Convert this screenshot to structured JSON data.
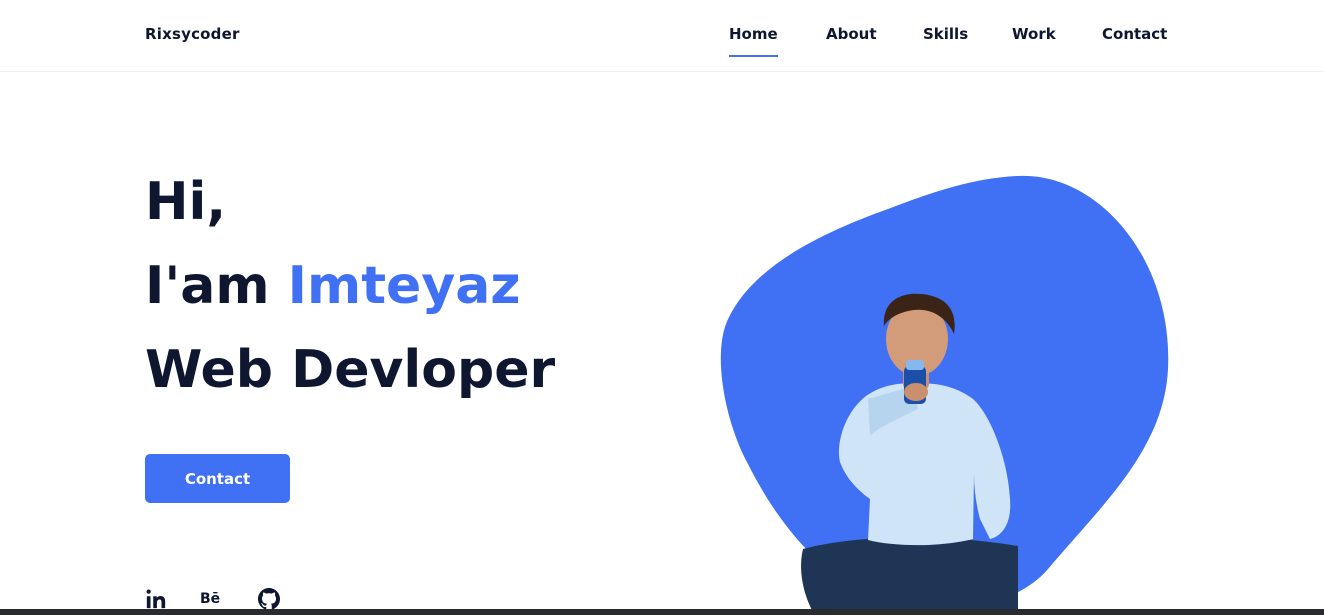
{
  "header": {
    "logo": "Rixsycoder",
    "nav": [
      {
        "label": "Home",
        "active": true
      },
      {
        "label": "About",
        "active": false
      },
      {
        "label": "Skills",
        "active": false
      },
      {
        "label": "Work",
        "active": false
      },
      {
        "label": "Contact",
        "active": false
      }
    ]
  },
  "hero": {
    "greeting": "Hi,",
    "intro_prefix": "I'am ",
    "name": "Imteyaz",
    "role": "Web Devloper",
    "button_label": "Contact"
  },
  "social": [
    {
      "icon": "linkedin-icon",
      "label": "in"
    },
    {
      "icon": "behance-icon",
      "label": "Bē"
    },
    {
      "icon": "github-icon",
      "label": ""
    }
  ],
  "colors": {
    "accent": "#4070f4",
    "text": "#0e1630",
    "background": "#ffffff"
  }
}
